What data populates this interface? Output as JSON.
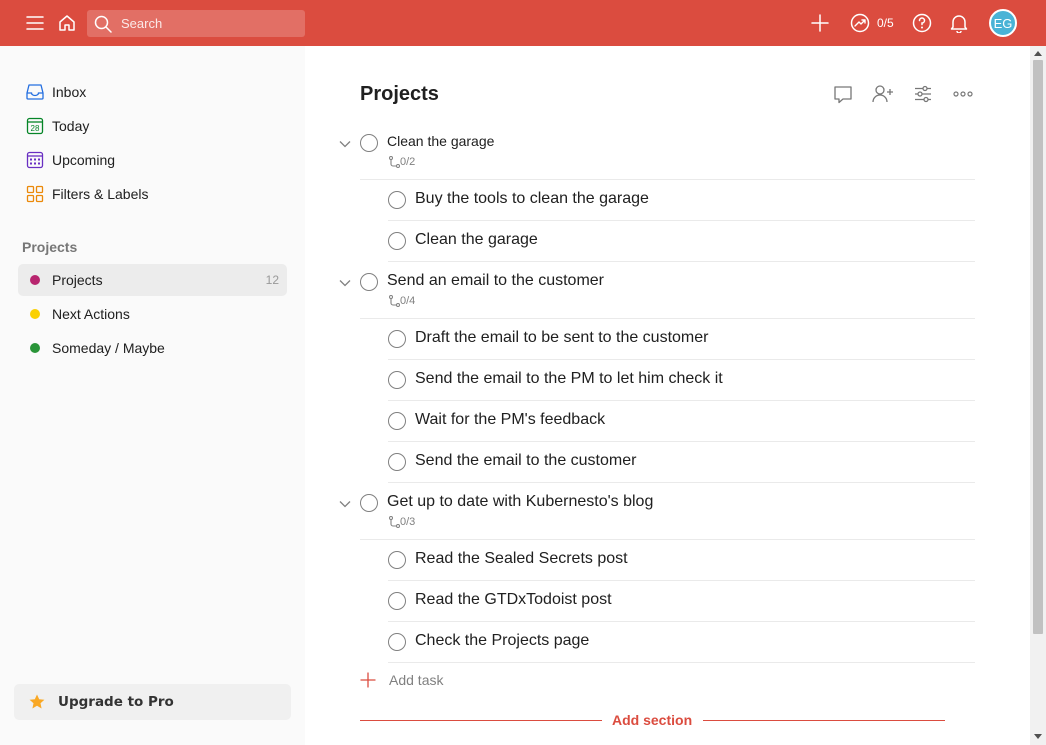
{
  "topbar": {
    "search_placeholder": "Search",
    "karma": "0/5",
    "avatar_initials": "EG"
  },
  "sidebar": {
    "nav": [
      {
        "label": "Inbox",
        "icon": "inbox-icon"
      },
      {
        "label": "Today",
        "icon": "calendar-today-icon",
        "day": "28"
      },
      {
        "label": "Upcoming",
        "icon": "calendar-upcoming-icon"
      },
      {
        "label": "Filters & Labels",
        "icon": "filters-labels-icon"
      }
    ],
    "projects_heading": "Projects",
    "projects": [
      {
        "label": "Projects",
        "count": "12",
        "color": "#b8256f"
      },
      {
        "label": "Next Actions",
        "count": "",
        "color": "#fad000"
      },
      {
        "label": "Someday / Maybe",
        "count": "",
        "color": "#299438"
      }
    ],
    "upgrade_label": "Upgrade to Pro"
  },
  "main": {
    "title": "Projects",
    "tasks": [
      {
        "title": "Clean the garage",
        "subcount": "0/2",
        "subtasks": [
          "Buy the tools to clean the garage",
          "Clean the garage"
        ]
      },
      {
        "title": "Send an email to the customer",
        "subcount": "0/4",
        "subtasks": [
          "Draft the email to be sent to the customer",
          "Send the email to the PM to let him check it",
          "Wait for the PM's feedback",
          "Send the email to the customer"
        ]
      },
      {
        "title": "Get up to date with Kubernesto's blog",
        "subcount": "0/3",
        "subtasks": [
          "Read the Sealed Secrets post",
          "Read the GTDxTodoist post",
          "Check the Projects page"
        ]
      }
    ],
    "add_task_label": "Add task",
    "add_section_label": "Add section"
  },
  "colors": {
    "accent": "#db4c3f",
    "sidebar_bg": "#fafafa"
  }
}
